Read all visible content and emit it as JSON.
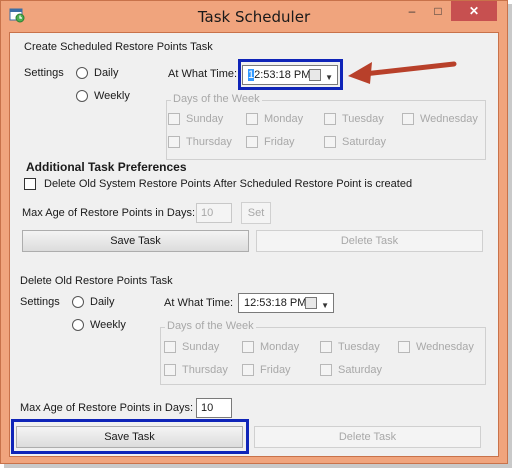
{
  "window": {
    "title": "Task Scheduler",
    "min_glyph": "–",
    "max_glyph": "□",
    "close_glyph": "✕"
  },
  "colors": {
    "frame": "#f0a47d",
    "highlight": "#0f24b8",
    "arrow": "#b8402a"
  },
  "create_task": {
    "heading": "Create Scheduled Restore Points Task",
    "settings_label": "Settings",
    "radio_daily": "Daily",
    "radio_weekly": "Weekly",
    "time_label": "At What Time:",
    "time_cursor": "1",
    "time_rest": "2:53:18 PM",
    "days_group": "Days of the Week",
    "days": [
      "Sunday",
      "Monday",
      "Tuesday",
      "Wednesday",
      "Thursday",
      "Friday",
      "Saturday"
    ]
  },
  "additional": {
    "heading": "Additional Task Preferences",
    "delete_checkbox_label": "Delete Old System Restore Points After Scheduled Restore Point is created",
    "max_age_label": "Max Age of Restore Points in Days:",
    "max_age_value": "10",
    "set_button": "Set",
    "save_button": "Save Task",
    "delete_button": "Delete Task"
  },
  "delete_task": {
    "heading": "Delete Old Restore Points Task",
    "settings_label": "Settings",
    "radio_daily": "Daily",
    "radio_weekly": "Weekly",
    "time_label": "At What Time:",
    "time_value": "12:53:18 PM",
    "days_group": "Days of the Week",
    "days": [
      "Sunday",
      "Monday",
      "Tuesday",
      "Wednesday",
      "Thursday",
      "Friday",
      "Saturday"
    ],
    "max_age_label": "Max Age of Restore Points in Days:",
    "max_age_value": "10",
    "save_button": "Save Task",
    "delete_button": "Delete Task"
  }
}
